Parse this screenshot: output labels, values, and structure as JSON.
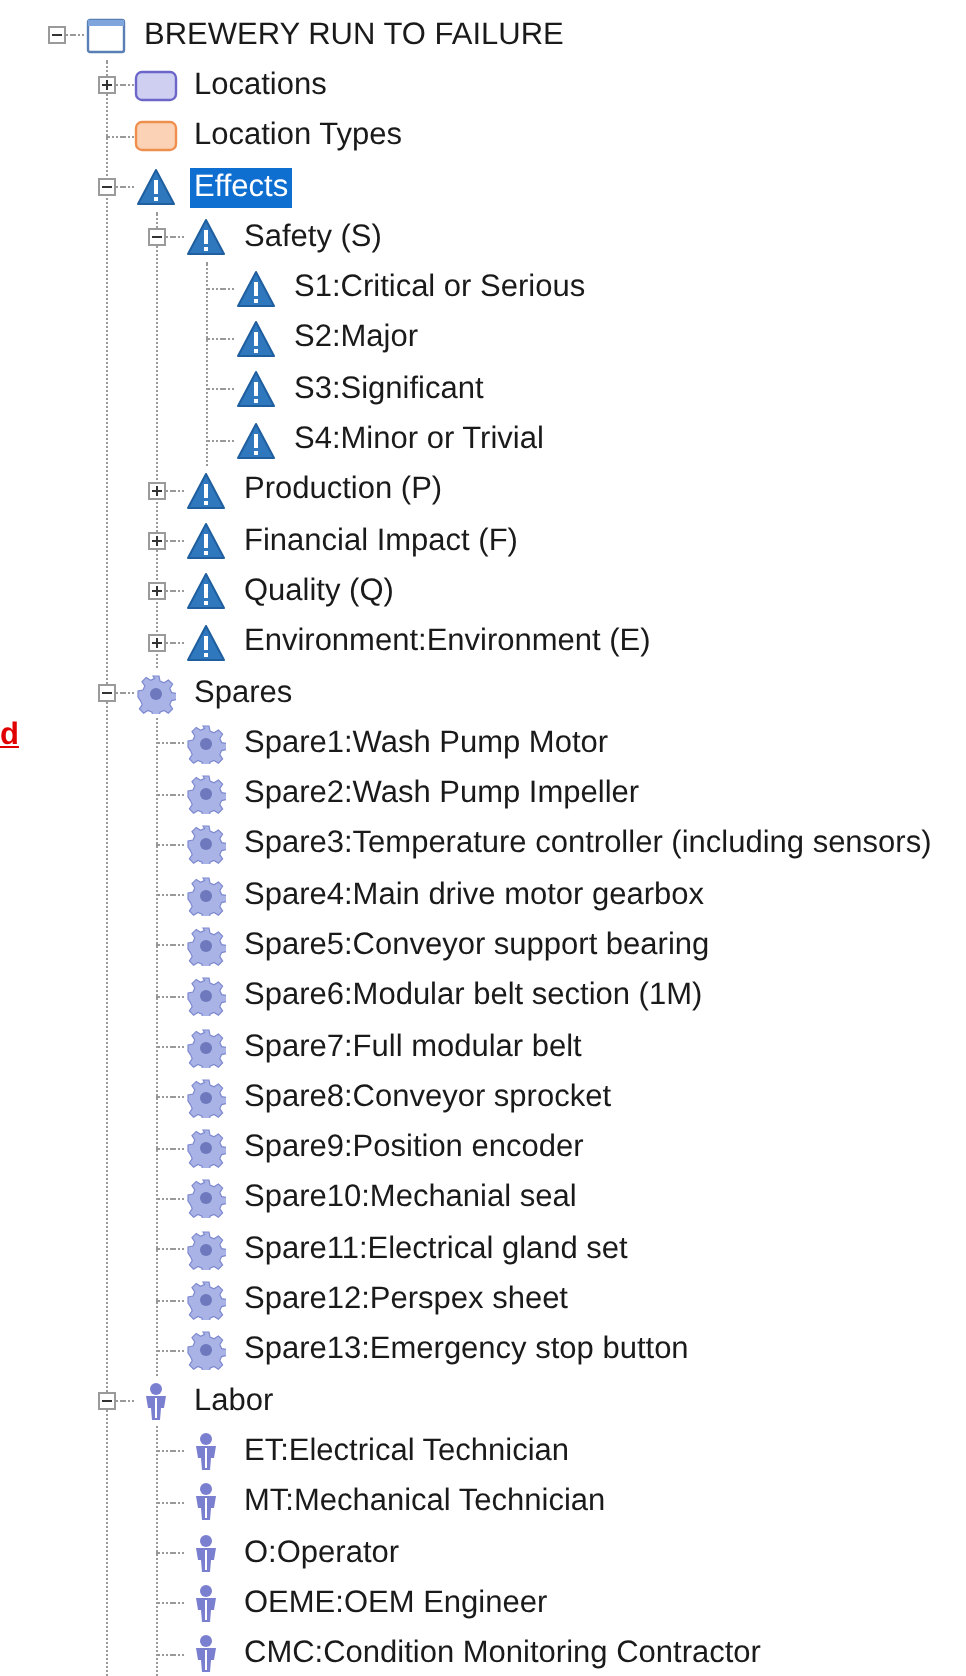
{
  "side_link": "d",
  "tree": [
    {
      "label": "BREWERY RUN TO FAILURE",
      "kind": "window",
      "selected": false,
      "expanded": true,
      "children": [
        {
          "label": "Locations",
          "kind": "location",
          "selected": false,
          "expanded": false
        },
        {
          "label": "Location Types",
          "kind": "location_type",
          "selected": false
        },
        {
          "label": "Effects",
          "kind": "warning",
          "selected": true,
          "expanded": true,
          "children": [
            {
              "label": "Safety (S)",
              "kind": "warning",
              "selected": false,
              "expanded": true,
              "children": [
                {
                  "label": "S1:Critical or Serious",
                  "kind": "warning",
                  "selected": false
                },
                {
                  "label": "S2:Major",
                  "kind": "warning",
                  "selected": false
                },
                {
                  "label": "S3:Significant",
                  "kind": "warning",
                  "selected": false
                },
                {
                  "label": "S4:Minor or Trivial",
                  "kind": "warning",
                  "selected": false
                }
              ]
            },
            {
              "label": "Production (P)",
              "kind": "warning",
              "selected": false,
              "expanded": false
            },
            {
              "label": "Financial Impact (F)",
              "kind": "warning",
              "selected": false,
              "expanded": false
            },
            {
              "label": "Quality (Q)",
              "kind": "warning",
              "selected": false,
              "expanded": false
            },
            {
              "label": "Environment:Environment (E)",
              "kind": "warning",
              "selected": false,
              "expanded": false
            }
          ]
        },
        {
          "label": "Spares",
          "kind": "gear",
          "selected": false,
          "expanded": true,
          "children": [
            {
              "label": "Spare1:Wash Pump Motor",
              "kind": "gear",
              "selected": false
            },
            {
              "label": "Spare2:Wash Pump Impeller",
              "kind": "gear",
              "selected": false
            },
            {
              "label": "Spare3:Temperature controller (including sensors)",
              "kind": "gear",
              "selected": false
            },
            {
              "label": "Spare4:Main drive motor gearbox",
              "kind": "gear",
              "selected": false
            },
            {
              "label": "Spare5:Conveyor support bearing",
              "kind": "gear",
              "selected": false
            },
            {
              "label": "Spare6:Modular belt section (1M)",
              "kind": "gear",
              "selected": false
            },
            {
              "label": "Spare7:Full modular belt",
              "kind": "gear",
              "selected": false
            },
            {
              "label": "Spare8:Conveyor sprocket",
              "kind": "gear",
              "selected": false
            },
            {
              "label": "Spare9:Position encoder",
              "kind": "gear",
              "selected": false
            },
            {
              "label": "Spare10:Mechanial seal",
              "kind": "gear",
              "selected": false
            },
            {
              "label": "Spare11:Electrical gland set",
              "kind": "gear",
              "selected": false
            },
            {
              "label": "Spare12:Perspex sheet",
              "kind": "gear",
              "selected": false
            },
            {
              "label": "Spare13:Emergency stop button",
              "kind": "gear",
              "selected": false
            }
          ]
        },
        {
          "label": "Labor",
          "kind": "person",
          "selected": false,
          "expanded": true,
          "children": [
            {
              "label": "ET:Electrical Technician",
              "kind": "person",
              "selected": false
            },
            {
              "label": "MT:Mechanical Technician",
              "kind": "person",
              "selected": false
            },
            {
              "label": "O:Operator",
              "kind": "person",
              "selected": false
            },
            {
              "label": "OEME:OEM Engineer",
              "kind": "person",
              "selected": false
            },
            {
              "label": "CMC:Condition Monitoring Contractor",
              "kind": "person",
              "selected": false
            }
          ]
        }
      ]
    }
  ]
}
